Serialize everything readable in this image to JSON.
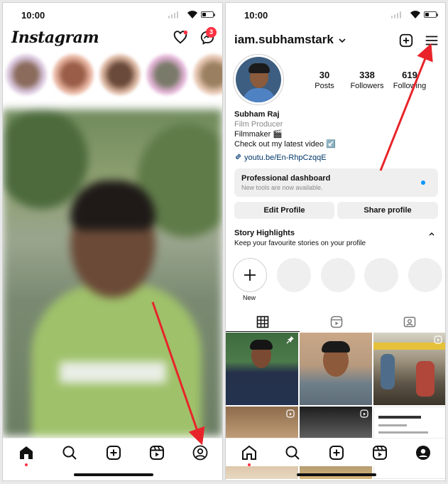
{
  "left": {
    "status_time": "10:00",
    "logo": "Instagram",
    "messages_badge": "3",
    "icons": {
      "notifications": "heart-icon",
      "messages": "messenger-icon"
    },
    "tabs": [
      "home-icon",
      "search-icon",
      "create-icon",
      "reels-icon",
      "profile-icon"
    ]
  },
  "right": {
    "status_time": "10:00",
    "username": "iam.subhamstark",
    "stats": [
      {
        "num": "30",
        "label": "Posts"
      },
      {
        "num": "338",
        "label": "Followers"
      },
      {
        "num": "619",
        "label": "Following"
      }
    ],
    "bio": {
      "name": "Subham Raj",
      "category": "Film Producer",
      "line1": "Filmmaker 🎬",
      "line2": "Check out my latest video ↙️"
    },
    "link": "youtu.be/En-RhpCzqqE",
    "dashboard": {
      "title": "Professional dashboard",
      "subtitle": "New tools are now available."
    },
    "buttons": {
      "edit": "Edit Profile",
      "share": "Share profile"
    },
    "highlights": {
      "title": "Story Highlights",
      "subtitle": "Keep your favourite stories on your profile",
      "new_label": "New"
    },
    "tabs": [
      "home-icon",
      "search-icon",
      "create-icon",
      "reels-icon",
      "profile-icon"
    ]
  },
  "colors": {
    "accent_arrow": "#e8242a",
    "notification_red": "#ff3040",
    "link_blue": "#00376b",
    "dot_blue": "#0095f6"
  }
}
